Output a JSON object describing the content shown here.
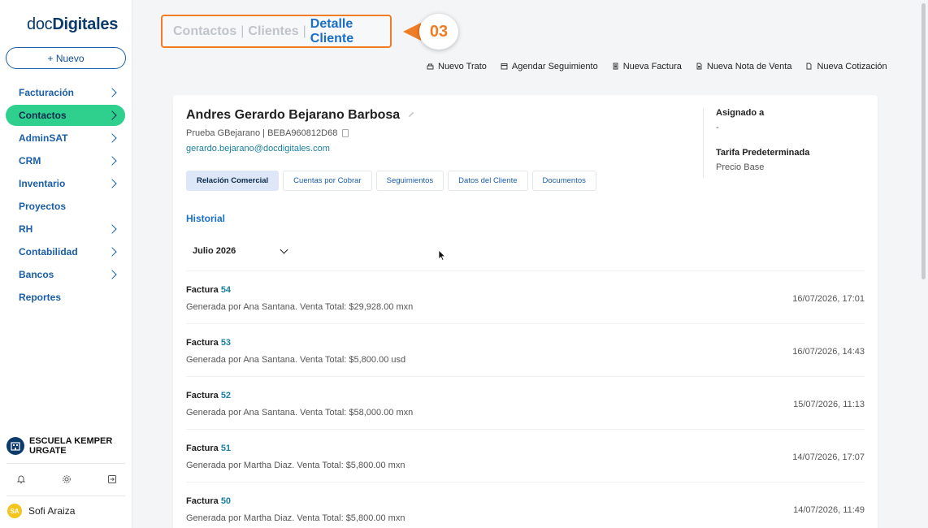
{
  "brand": {
    "logo_prefix": "doc",
    "logo_main": "Digitales"
  },
  "sidebar": {
    "new_button": "+ Nuevo",
    "items": [
      {
        "label": "Facturación",
        "has_chevron": true
      },
      {
        "label": "Contactos",
        "has_chevron": true,
        "active": true
      },
      {
        "label": "AdminSAT",
        "has_chevron": true
      },
      {
        "label": "CRM",
        "has_chevron": true
      },
      {
        "label": "Inventario",
        "has_chevron": true
      },
      {
        "label": "Proyectos",
        "has_chevron": false
      },
      {
        "label": "RH",
        "has_chevron": true
      },
      {
        "label": "Contabilidad",
        "has_chevron": true
      },
      {
        "label": "Bancos",
        "has_chevron": true
      },
      {
        "label": "Reportes",
        "has_chevron": false
      }
    ],
    "company": "ESCUELA KEMPER URGATE",
    "bottom_icons": [
      "bell-icon",
      "gear-icon",
      "logout-icon"
    ],
    "user": {
      "initials": "SA",
      "name": "Sofi Araiza"
    }
  },
  "breadcrumb": {
    "item1": "Contactos",
    "item2": "Clientes",
    "current": "Detalle Cliente",
    "separator": "|"
  },
  "step_marker": "03",
  "actions": [
    {
      "label": "Nuevo Trato",
      "icon": "handshake-icon"
    },
    {
      "label": "Agendar Seguimiento",
      "icon": "calendar-icon"
    },
    {
      "label": "Nueva Factura",
      "icon": "invoice-icon"
    },
    {
      "label": "Nueva Nota de Venta",
      "icon": "note-icon"
    },
    {
      "label": "Nueva Cotización",
      "icon": "document-icon"
    }
  ],
  "client": {
    "name": "Andres Gerardo Bejarano Barbosa",
    "subtitle": "Prueba GBejarano | BEBA960812D68",
    "email": "gerardo.bejarano@docdigitales.com",
    "assigned_label": "Asignado a",
    "assigned_value": "-",
    "tariff_label": "Tarifa Predeterminada",
    "tariff_value": "Precio Base"
  },
  "tabs": [
    {
      "label": "Relación Comercial",
      "active": true
    },
    {
      "label": "Cuentas por Cobrar"
    },
    {
      "label": "Seguimientos"
    },
    {
      "label": "Datos del Cliente"
    },
    {
      "label": "Documentos"
    }
  ],
  "historial": {
    "title": "Historial",
    "month": "Julio 2026",
    "entries": [
      {
        "type": "Factura",
        "number": "54",
        "description": "Generada por Ana Santana. Venta Total: $29,928.00 mxn",
        "date": "16/07/2026, 17:01"
      },
      {
        "type": "Factura",
        "number": "53",
        "description": "Generada por Ana Santana. Venta Total: $5,800.00 usd",
        "date": "16/07/2026, 14:43"
      },
      {
        "type": "Factura",
        "number": "52",
        "description": "Generada por Ana Santana. Venta Total: $58,000.00 mxn",
        "date": "15/07/2026, 11:13"
      },
      {
        "type": "Factura",
        "number": "51",
        "description": "Generada por Martha Diaz. Venta Total: $5,800.00 mxn",
        "date": "14/07/2026, 17:07"
      },
      {
        "type": "Factura",
        "number": "50",
        "description": "Generada por Martha Diaz. Venta Total: $5,800.00 mxn",
        "date": "14/07/2026, 11:49"
      }
    ]
  },
  "colors": {
    "accent_green": "#2fd08d",
    "brand_blue": "#1a6fc4",
    "highlight_orange": "#f07d25",
    "link_teal": "#1a7fa0"
  }
}
